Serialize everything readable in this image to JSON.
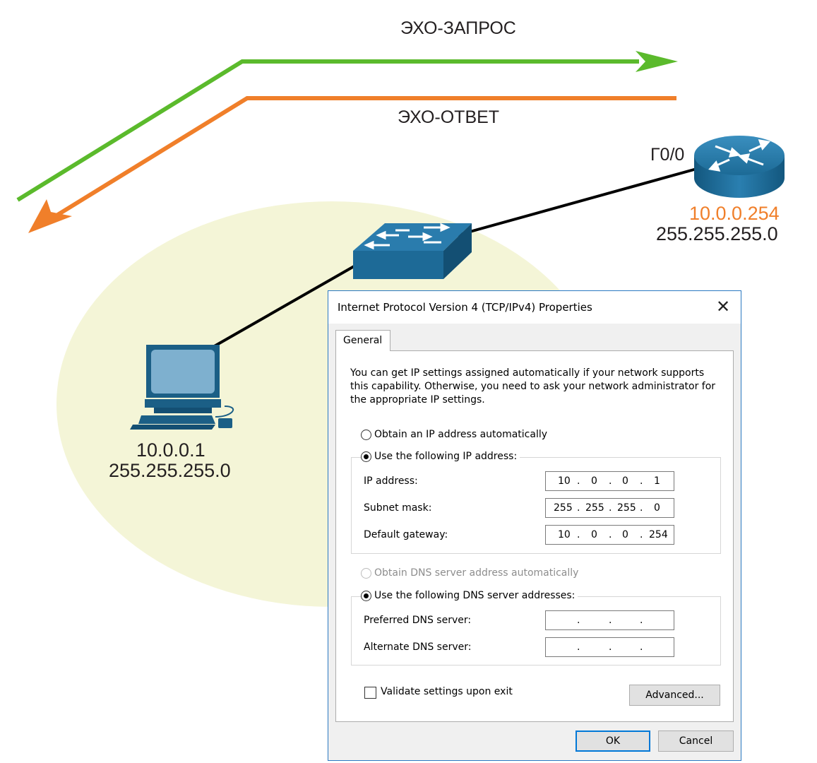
{
  "diagram": {
    "echo_request_label": "ЭХО-ЗАПРОС",
    "echo_reply_label": "ЭХО-ОТВЕТ",
    "router_interface": "Г0/0",
    "router_ip": "10.0.0.254",
    "router_mask": "255.255.255.0",
    "pc_ip": "10.0.0.1",
    "pc_mask": "255.255.255.0",
    "colors": {
      "request_arrow": "#5bba2c",
      "reply_arrow": "#f07f2a",
      "lan_zone": "#f4f5d7",
      "device_blue": "#1b5f86",
      "router_ip_text": "#f07f2a"
    }
  },
  "dialog": {
    "title": "Internet Protocol Version 4 (TCP/IPv4) Properties",
    "close_icon": "close-icon",
    "tab_general": "General",
    "intro": "You can get IP settings assigned automatically if your network supports this capability. Otherwise, you need to ask your network administrator for the appropriate IP settings.",
    "obtain_ip_auto": "Obtain an IP address automatically",
    "use_following_ip": "Use the following IP address:",
    "ip_address_label": "IP address:",
    "subnet_mask_label": "Subnet mask:",
    "default_gateway_label": "Default gateway:",
    "ip_address": [
      "10",
      "0",
      "0",
      "1"
    ],
    "subnet_mask": [
      "255",
      "255",
      "255",
      "0"
    ],
    "default_gateway": [
      "10",
      "0",
      "0",
      "254"
    ],
    "obtain_dns_auto": "Obtain DNS server address automatically",
    "use_following_dns": "Use the following DNS server addresses:",
    "preferred_dns_label": "Preferred DNS server:",
    "alternate_dns_label": "Alternate DNS server:",
    "validate_label": "Validate settings upon exit",
    "advanced_button": "Advanced...",
    "ok_button": "OK",
    "cancel_button": "Cancel"
  }
}
